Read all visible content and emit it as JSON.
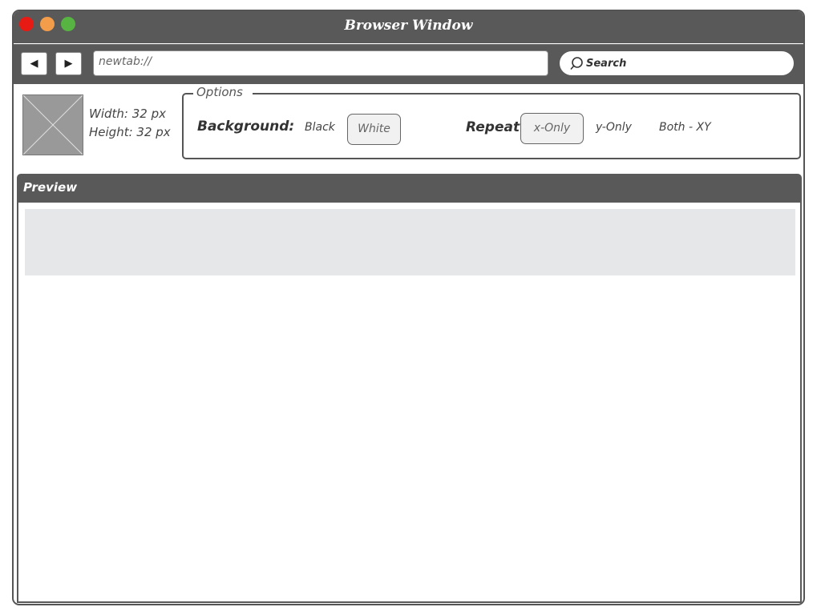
{
  "window": {
    "title": "Browser Window"
  },
  "toolbar": {
    "back_label": "◀",
    "forward_label": "▶",
    "url_value": "newtab://",
    "search_label": "Search"
  },
  "image_info": {
    "width_text": "Width: 32 px",
    "height_text": "Height: 32 px"
  },
  "options": {
    "legend": "Options",
    "background": {
      "label": "Background:",
      "choices": [
        "Black",
        "White"
      ],
      "selected": "White"
    },
    "repeat": {
      "label": "Repeat:",
      "choices": [
        "x-Only",
        "y-Only",
        "Both - XY"
      ],
      "selected": "x-Only"
    }
  },
  "preview": {
    "title": "Preview"
  },
  "colors": {
    "chrome": "#595959",
    "close": "#e81a14",
    "minimize": "#f39c4a",
    "maximize": "#57b342",
    "preview_strip": "#e5e7e8"
  },
  "icons": {
    "back": "back-arrow-icon",
    "forward": "forward-arrow-icon",
    "search": "search-icon",
    "image_placeholder": "image-placeholder-icon"
  }
}
